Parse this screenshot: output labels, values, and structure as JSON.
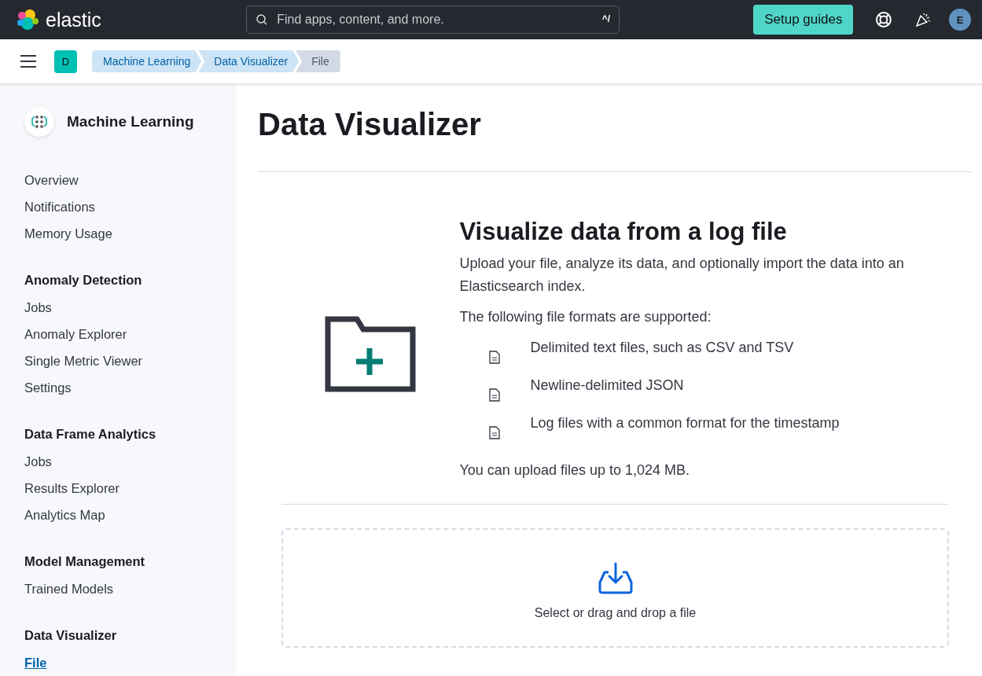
{
  "header": {
    "logo_text": "elastic",
    "search": {
      "placeholder": "Find apps, content, and more.",
      "shortcut": "^/"
    },
    "setup_button": "Setup guides",
    "avatar": "E"
  },
  "subheader": {
    "space_badge": "D",
    "breadcrumbs": [
      {
        "label": "Machine Learning",
        "selected": false
      },
      {
        "label": "Data Visualizer",
        "selected": false
      },
      {
        "label": "File",
        "selected": true
      }
    ]
  },
  "sidebar": {
    "title": "Machine Learning",
    "groups": [
      {
        "items": [
          {
            "label": "Overview",
            "selected": false
          },
          {
            "label": "Notifications",
            "selected": false
          },
          {
            "label": "Memory Usage",
            "selected": false
          }
        ]
      },
      {
        "title": "Anomaly Detection",
        "items": [
          {
            "label": "Jobs",
            "selected": false
          },
          {
            "label": "Anomaly Explorer",
            "selected": false
          },
          {
            "label": "Single Metric Viewer",
            "selected": false
          },
          {
            "label": "Settings",
            "selected": false
          }
        ]
      },
      {
        "title": "Data Frame Analytics",
        "items": [
          {
            "label": "Jobs",
            "selected": false
          },
          {
            "label": "Results Explorer",
            "selected": false
          },
          {
            "label": "Analytics Map",
            "selected": false
          }
        ]
      },
      {
        "title": "Model Management",
        "items": [
          {
            "label": "Trained Models",
            "selected": false
          }
        ]
      },
      {
        "title": "Data Visualizer",
        "items": [
          {
            "label": "File",
            "selected": true
          }
        ]
      }
    ]
  },
  "main": {
    "page_title": "Data Visualizer",
    "heading": "Visualize data from a log file",
    "description": "Upload your file, analyze its data, and optionally import the data into an Elasticsearch index.",
    "formats_intro": "The following file formats are supported:",
    "formats": [
      "Delimited text files, such as CSV and TSV",
      "Newline-delimited JSON",
      "Log files with a common format for the timestamp"
    ],
    "limit_text": "You can upload files up to 1,024 MB.",
    "dropzone_label": "Select or drag and drop a file"
  }
}
